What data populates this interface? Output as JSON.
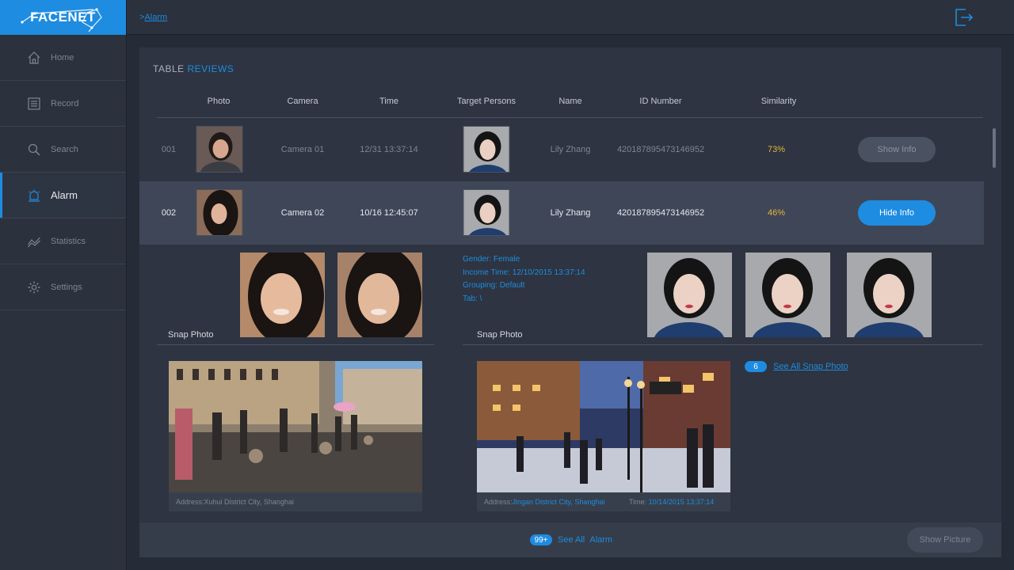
{
  "app": {
    "logo_text": "FACENET"
  },
  "sidebar": {
    "items": [
      {
        "label": "Home",
        "icon": "home-icon"
      },
      {
        "label": "Record",
        "icon": "list-icon"
      },
      {
        "label": "Search",
        "icon": "search-icon"
      },
      {
        "label": "Alarm",
        "icon": "alarm-icon",
        "active": true
      },
      {
        "label": "Statistics",
        "icon": "chart-icon"
      },
      {
        "label": "Settings",
        "icon": "gear-icon"
      }
    ]
  },
  "topbar": {
    "breadcrumb_prefix": ">",
    "breadcrumb": "Alarm",
    "logout_icon": "logout-icon"
  },
  "table": {
    "title_part1": "TABLE ",
    "title_part2": "REVIEWS",
    "columns": [
      "Photo",
      "Camera",
      "Time",
      "Target Persons",
      "Name",
      "ID Number",
      "Similarity"
    ],
    "rows": [
      {
        "index": "001",
        "camera": "Camera 01",
        "time": "12/31 13:37:14",
        "name": "Lily Zhang",
        "id_number": "420187895473146952",
        "similarity": "73%",
        "button": "Show Info"
      },
      {
        "index": "002",
        "camera": "Camera 02",
        "time": "10/16 12:45:07",
        "name": "Lily Zhang",
        "id_number": "420187895473146952",
        "similarity": "46%",
        "button": "Hide Info"
      }
    ]
  },
  "detail": {
    "left_label": "Snap Photo",
    "right_label": "Snap Photo",
    "info": {
      "gender": "Gender: Female",
      "income_time": "Income Time: 12/10/2015 13:37:14",
      "grouping": "Grouping: Default",
      "tab": "Tab: \\"
    },
    "left_address_label": "Address: ",
    "left_address_value": "Xuhui District City, Shanghai",
    "right_address_label": "Address: ",
    "right_address_value": "Jingan District City, Shanghai",
    "right_time_label": "Time: ",
    "right_time_value": "10/14/2015 13:37:14",
    "snap_count": "6",
    "see_all_snap": "See All Snap Photo"
  },
  "footer": {
    "alarm_count": "99+",
    "see_all": "See All",
    "alarm": "Alarm",
    "show_picture": "Show Picture"
  },
  "colors": {
    "accent": "#1e8ce0",
    "similarity": "#e8b53a",
    "background": "#262c37"
  }
}
